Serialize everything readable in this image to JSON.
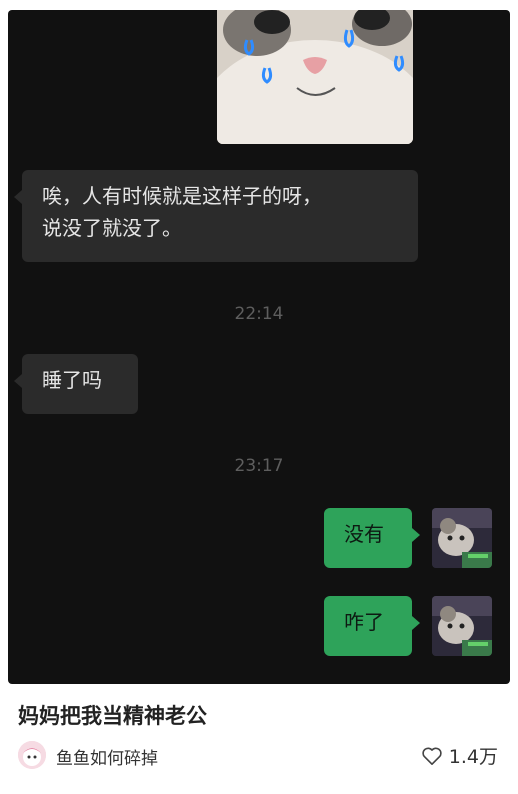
{
  "chat": {
    "messages": [
      {
        "type": "sticker",
        "side": "incoming",
        "icon": "crying-cat-sticker-icon"
      },
      {
        "type": "text",
        "side": "incoming",
        "line1": "唉，人有时候就是这样子的呀，",
        "line2": "说没了就没了。"
      },
      {
        "type": "time",
        "text": "22:14"
      },
      {
        "type": "text",
        "side": "incoming",
        "text": "睡了吗"
      },
      {
        "type": "time",
        "text": "23:17"
      },
      {
        "type": "text",
        "side": "outgoing",
        "text": "没有"
      },
      {
        "type": "text",
        "side": "outgoing",
        "text": "咋了"
      }
    ]
  },
  "post": {
    "title": "妈妈把我当精神老公",
    "author": "鱼鱼如何碎掉",
    "likes": "1.4万"
  },
  "colors": {
    "chat_bg": "#111111",
    "incoming_bubble": "#2b2b2b",
    "outgoing_bubble": "#2ea35a"
  }
}
